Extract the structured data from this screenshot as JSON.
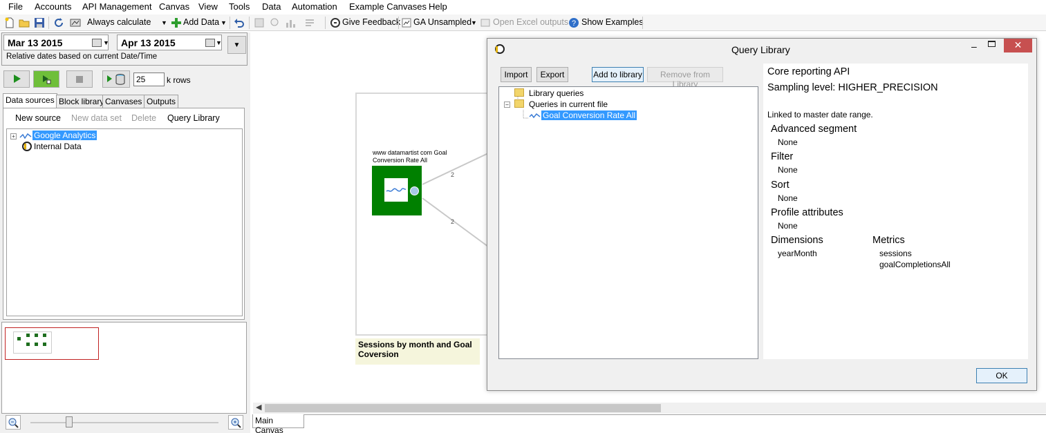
{
  "menu": [
    "File",
    "Accounts",
    "API Management",
    "Canvas",
    "View",
    "Tools",
    "Data",
    "Automation",
    "Example Canvases",
    "Help"
  ],
  "toolbar": {
    "always_calculate": "Always calculate",
    "add_data": "Add Data",
    "give_feedback": "Give Feedback",
    "ga_unsampled": "GA Unsampled",
    "open_excel": "Open Excel outputs",
    "show_examples": "Show Examples"
  },
  "dates": {
    "start": "Mar 13 2015",
    "end": "Apr 13 2015",
    "relative_note": "Relative dates based on current Date/Time"
  },
  "rows": {
    "value": "25",
    "unit": "k rows"
  },
  "left_tabs": [
    "Data sources",
    "Block library",
    "Canvases",
    "Outputs"
  ],
  "source_toolbar": {
    "new_source": "New source",
    "new_data_set": "New data set",
    "delete": "Delete",
    "query_library": "Query Library"
  },
  "sources_tree": [
    "Google Analytics",
    "Internal Data"
  ],
  "canvas": {
    "block_title": "www datamartist com Goal Conversion Rate  All",
    "edge_labels": [
      "2",
      "2"
    ],
    "note": "Sessions by month and Goal Coversion",
    "tab": "Main Canvas"
  },
  "dialog": {
    "title": "Query Library",
    "buttons": {
      "import": "Import",
      "export": "Export",
      "add_to_library": "Add to library",
      "remove": "Remove from Library",
      "ok": "OK"
    },
    "tree": {
      "library_queries": "Library queries",
      "queries_in_file": "Queries in current file",
      "selected_query": "Goal Conversion Rate  All"
    },
    "details": {
      "api": "Core reporting API",
      "sampling": "Sampling level: HIGHER_PRECISION",
      "linked": "Linked to master date range.",
      "advanced_segment_label": "Advanced segment",
      "advanced_segment_value": "None",
      "filter_label": "Filter",
      "filter_value": "None",
      "sort_label": "Sort",
      "sort_value": "None",
      "profile_label": "Profile attributes",
      "profile_value": "None",
      "dimensions_label": "Dimensions",
      "dimensions": [
        "yearMonth"
      ],
      "metrics_label": "Metrics",
      "metrics": [
        "sessions",
        "goalCompletionsAll"
      ]
    }
  },
  "colors": {
    "selection": "#3399ff",
    "block_green": "#008000",
    "close_red": "#c75050",
    "note_bg": "#f5f5dc"
  }
}
